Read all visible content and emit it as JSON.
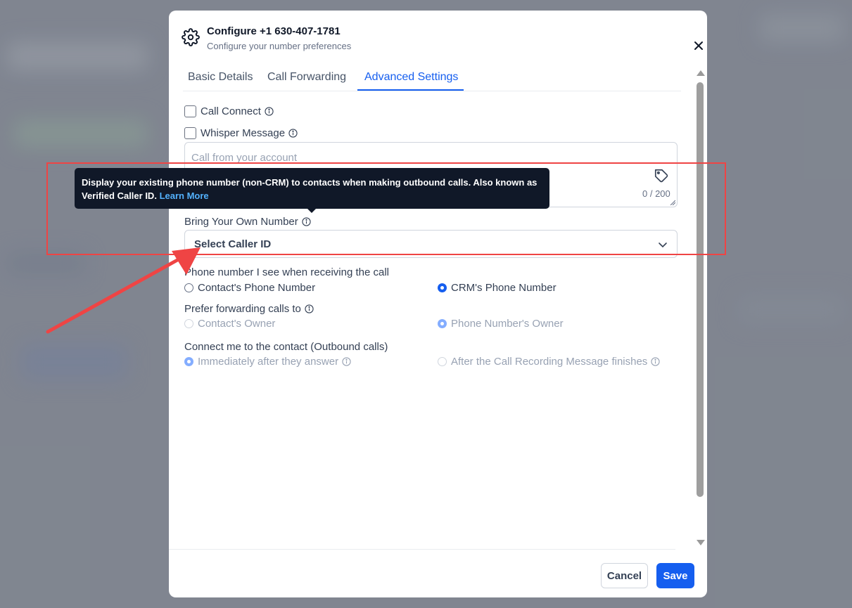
{
  "modal": {
    "title": "Configure +1 630-407-1781",
    "subtitle": "Configure your number preferences",
    "close_icon": "close-icon"
  },
  "tabs": [
    {
      "label": "Basic Details",
      "active": false
    },
    {
      "label": "Call Forwarding",
      "active": false
    },
    {
      "label": "Advanced Settings",
      "active": true
    }
  ],
  "settings": {
    "call_connect": {
      "label": "Call Connect",
      "checked": false
    },
    "whisper_message": {
      "label": "Whisper Message",
      "checked": false
    },
    "whisper_text": {
      "placeholder": "Call from your account",
      "char_count": "0 / 200"
    },
    "byon": {
      "label": "Bring Your Own Number",
      "select_value": "Select Caller ID"
    },
    "phone_seen": {
      "label": "Phone number I see when receiving the call",
      "options": [
        {
          "label": "Contact's Phone Number",
          "checked": false
        },
        {
          "label": "CRM's Phone Number",
          "checked": true
        }
      ]
    },
    "prefer_forwarding": {
      "label": "Prefer forwarding calls to",
      "options": [
        {
          "label": "Contact's Owner",
          "checked": false
        },
        {
          "label": "Phone Number's Owner",
          "checked": true
        }
      ]
    },
    "connect_me": {
      "label": "Connect me to the contact (Outbound calls)",
      "options": [
        {
          "label": "Immediately after they answer",
          "checked": true
        },
        {
          "label": "After the Call Recording Message finishes",
          "checked": false
        }
      ]
    }
  },
  "tooltip": {
    "text": "Display your existing phone number (non-CRM) to contacts when making outbound calls. Also known as Verified Caller ID.",
    "link": "Learn More"
  },
  "footer": {
    "cancel_label": "Cancel",
    "save_label": "Save"
  },
  "colors": {
    "accent": "#155eef",
    "annotation": "#ef4444",
    "tooltip_bg": "#101828"
  }
}
